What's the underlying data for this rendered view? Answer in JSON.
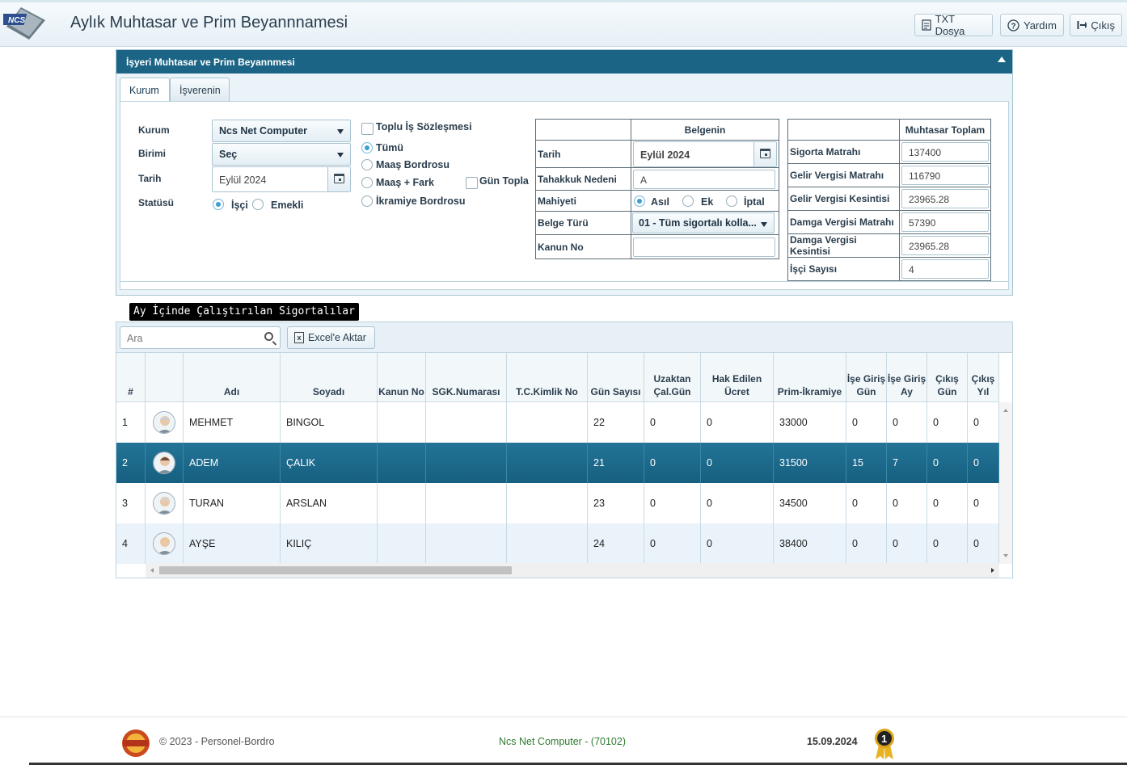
{
  "header": {
    "title": "Aylık Muhtasar ve Prim Beyannnamesi",
    "logo_text": "NCS",
    "buttons": {
      "txt": "TXT Dosya",
      "help": "Yardım",
      "exit": "Çıkış"
    }
  },
  "panel": {
    "title": "İşyeri Muhtasar ve Prim Beyannmesi",
    "tabs": [
      "Kurum",
      "İşverenin"
    ],
    "form": {
      "kurum_label": "Kurum",
      "kurum_value": "Ncs Net Computer",
      "birimi_label": "Birimi",
      "birimi_value": "Seç",
      "tarih_label": "Tarih",
      "tarih_value": "Eylül 2024",
      "statusu_label": "Statüsü",
      "statu_options": [
        "İşçi",
        "Emekli"
      ],
      "statu_selected": "İşçi"
    },
    "options": {
      "toplu_is": "Toplu İş Sözleşmesi",
      "bordro_options": [
        "Tümü",
        "Maaş Bordrosu",
        "Maaş + Fark",
        "İkramiye Bordrosu"
      ],
      "bordro_selected": "Tümü",
      "gun_topla": "Gün Topla"
    },
    "belgenin": {
      "header": "Belgenin",
      "tarih_label": "Tarih",
      "tarih_value": "Eylül 2024",
      "tahakkuk_label": "Tahakkuk Nedeni",
      "tahakkuk_value": "A",
      "mahiyet_label": "Mahiyeti",
      "mahiyet_options": [
        "Asıl",
        "Ek",
        "İptal"
      ],
      "mahiyet_selected": "Asıl",
      "belge_turu_label": "Belge Türü",
      "belge_turu_value": "01 - Tüm sigortalı kolla...",
      "kanun_label": "Kanun No",
      "kanun_value": ""
    },
    "muhtasar": {
      "header": "Muhtasar Toplam",
      "rows": [
        {
          "label": "Sigorta Matrahı",
          "value": "137400"
        },
        {
          "label": "Gelir Vergisi Matrahı",
          "value": "116790"
        },
        {
          "label": "Gelir Vergisi Kesintisi",
          "value": "23965.28"
        },
        {
          "label": "Damga Vergisi Matrahı",
          "value": "57390"
        },
        {
          "label": "Damga Vergisi Kesintisi",
          "value": "23965.28"
        },
        {
          "label": "İşçi Sayısı",
          "value": "4"
        }
      ]
    }
  },
  "grid": {
    "section_label": "Ay İçinde Çalıştırılan Sigortalılar",
    "search_placeholder": "Ara",
    "excel_button": "Excel'e Aktar",
    "columns": [
      "#",
      "",
      "Adı",
      "Soyadı",
      "Kanun No",
      "SGK.Numarası",
      "T.C.Kimlik No",
      "Gün Sayısı",
      "Uzaktan Çal.Gün",
      "Hak Edilen Ücret",
      "Prim-İkramiye",
      "İşe Giriş Gün",
      "İşe Giriş Ay",
      "Çıkış Gün",
      "Çıkış Yıl"
    ],
    "rows": [
      {
        "no": "1",
        "ad": "MEHMET",
        "soyad": "BINGOL",
        "kanun": "",
        "sgk": "",
        "tc": "",
        "gun": "22",
        "uzak": "0",
        "hak": "0",
        "prim": "33000",
        "giris_gun": "0",
        "giris_ay": "0",
        "cikis_gun": "0",
        "cikis_yil": "0"
      },
      {
        "no": "2",
        "ad": "ADEM",
        "soyad": "ÇALIK",
        "kanun": "",
        "sgk": "",
        "tc": "",
        "gun": "21",
        "uzak": "0",
        "hak": "0",
        "prim": "31500",
        "giris_gun": "15",
        "giris_ay": "7",
        "cikis_gun": "0",
        "cikis_yil": "0"
      },
      {
        "no": "3",
        "ad": "TURAN",
        "soyad": "ARSLAN",
        "kanun": "",
        "sgk": "",
        "tc": "",
        "gun": "23",
        "uzak": "0",
        "hak": "0",
        "prim": "34500",
        "giris_gun": "0",
        "giris_ay": "0",
        "cikis_gun": "0",
        "cikis_yil": "0"
      },
      {
        "no": "4",
        "ad": "AYŞE",
        "soyad": "KILIÇ",
        "kanun": "",
        "sgk": "",
        "tc": "",
        "gun": "24",
        "uzak": "0",
        "hak": "0",
        "prim": "38400",
        "giris_gun": "0",
        "giris_ay": "0",
        "cikis_gun": "0",
        "cikis_yil": "0"
      }
    ],
    "selected_row": 2
  },
  "footer": {
    "copyright": "© 2023 - Personel-Bordro",
    "company": "Ncs Net Computer - (70102)",
    "date": "15.09.2024",
    "badge_text": "1"
  },
  "colors": {
    "panel_header": "#1c6485",
    "selected_row": "#1d6a8c",
    "company_text": "#2f7a2f"
  }
}
